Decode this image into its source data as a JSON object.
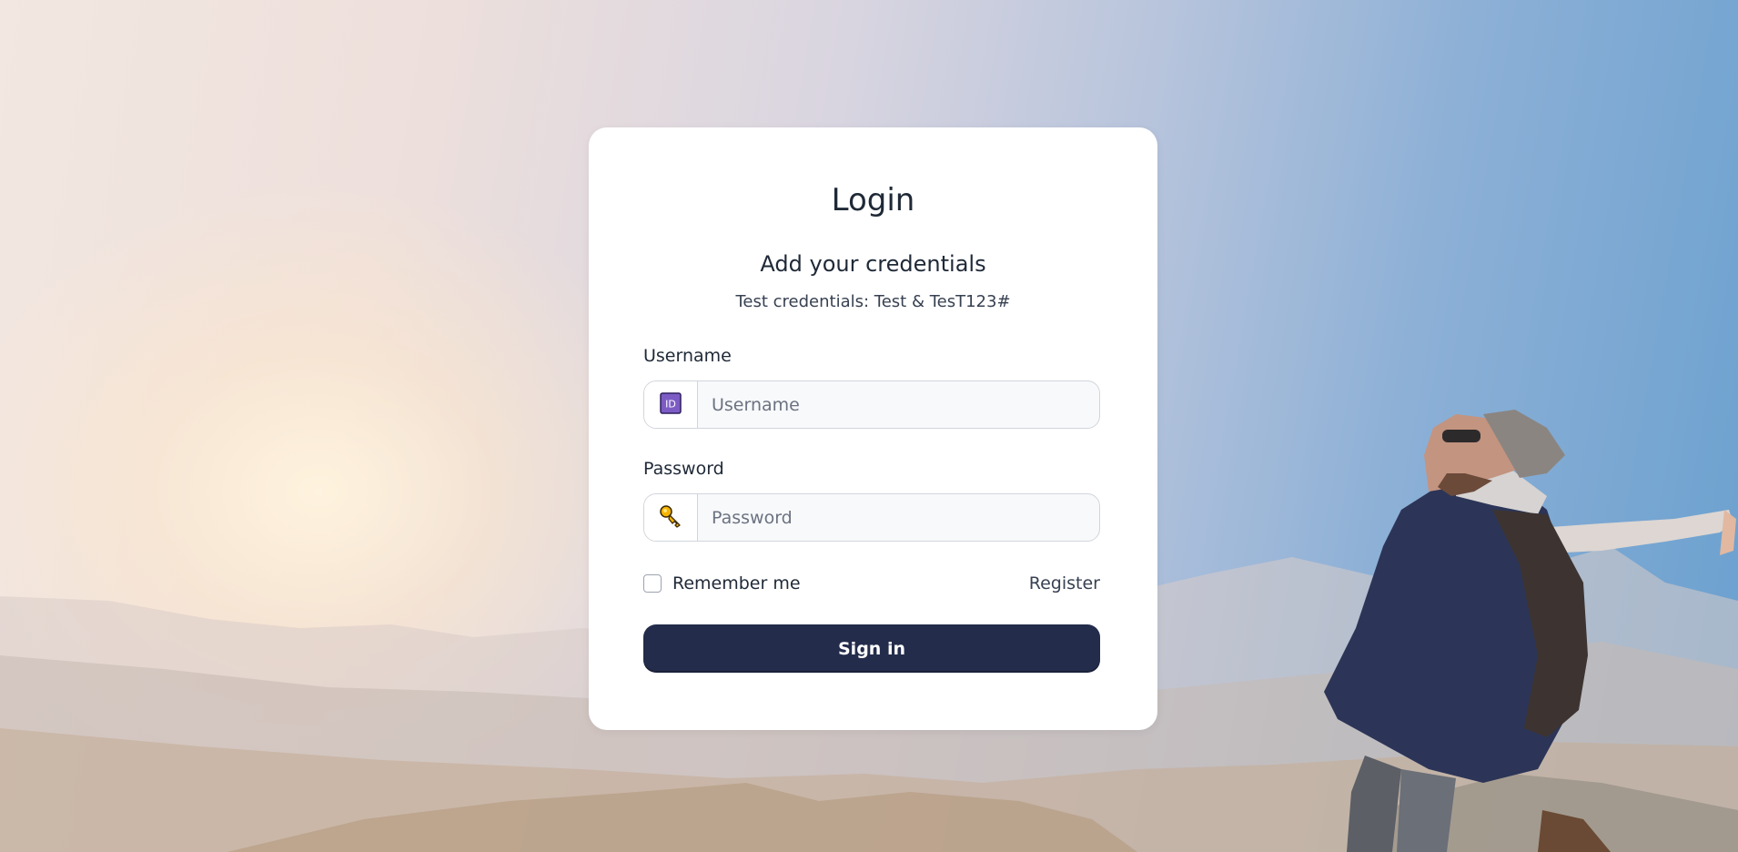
{
  "login": {
    "title": "Login",
    "subtitle": "Add your credentials",
    "hint": "Test credentials: Test & TesT123#",
    "username": {
      "label": "Username",
      "placeholder": "Username",
      "value": "",
      "icon": "id-icon"
    },
    "password": {
      "label": "Password",
      "placeholder": "Password",
      "value": "",
      "icon": "key-icon"
    },
    "remember_label": "Remember me",
    "remember_checked": false,
    "register_label": "Register",
    "signin_label": "Sign in"
  },
  "colors": {
    "button": "#232c4b",
    "title_text": "#1f2937",
    "id_icon": "#7c5cc4",
    "key_icon": "#f5b400"
  }
}
